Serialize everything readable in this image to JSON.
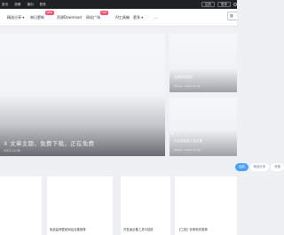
{
  "topbar": {
    "links": [
      "首页",
      "投稿",
      "福利",
      "登录"
    ],
    "buttons": [
      "注册",
      "登录"
    ]
  },
  "navbar": {
    "items": [
      {
        "label": "精选分享 ▾",
        "badge": ""
      },
      {
        "label": "每日更新",
        "badge": "NEW"
      },
      {
        "label": "资源Download",
        "badge": ""
      },
      {
        "label": "网站广场",
        "badge": "HOT"
      },
      {
        "label": "AI工具箱",
        "badge": ""
      },
      {
        "label": "更多 ▾",
        "badge": ""
      },
      {
        "label": "...",
        "badge": ""
      }
    ],
    "right_label": "搜"
  },
  "hero": {
    "title": "X 文章主题，免费下载，正在免费",
    "subtitle": "2022-11-08"
  },
  "side_cards": [
    {
      "title": "全部精选搭配",
      "meta": "Prolee · 2022-12-20"
    },
    {
      "title": "开发者推荐工具合集",
      "meta": "Prolee · 2022-12-20"
    }
  ],
  "tabs": [
    {
      "label": "全部",
      "active": true
    },
    {
      "label": "精选分享",
      "active": false
    },
    {
      "label": "资源",
      "active": false
    }
  ],
  "tiles": [
    {
      "title": ""
    },
    {
      "title": "免费高清壁纸网站合集推荐"
    },
    {
      "title": "开发者必备工具与插件"
    },
    {
      "title": "【工具】效率软件推荐"
    }
  ]
}
